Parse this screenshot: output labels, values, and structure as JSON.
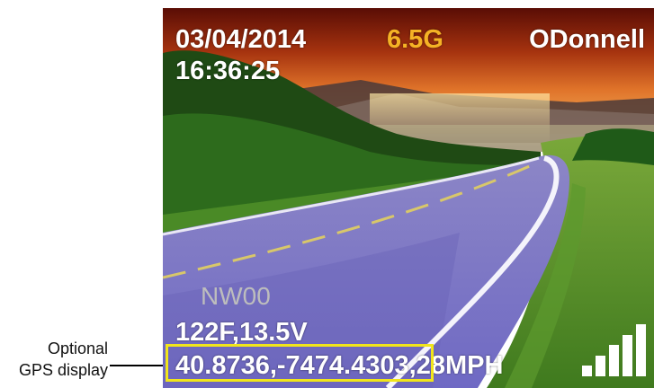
{
  "callout": {
    "line1": "Optional",
    "line2": "GPS display"
  },
  "osd": {
    "date": "03/04/2014",
    "time": "16:36:25",
    "gforce": "6.5G",
    "user": "ODonnell",
    "heading": "NW00",
    "temp_voltage": "122F,13.5V",
    "gps_coords": "40.8736,-7474.4303",
    "speed": ",28MPH"
  },
  "signal": {
    "bars_total": 5,
    "bars_lit": 5
  },
  "colors": {
    "gforce": "#f5b225",
    "gps_highlight_box": "#f1e51b",
    "osd_text": "#ffffff",
    "heading_text": "#bdbdbd"
  }
}
